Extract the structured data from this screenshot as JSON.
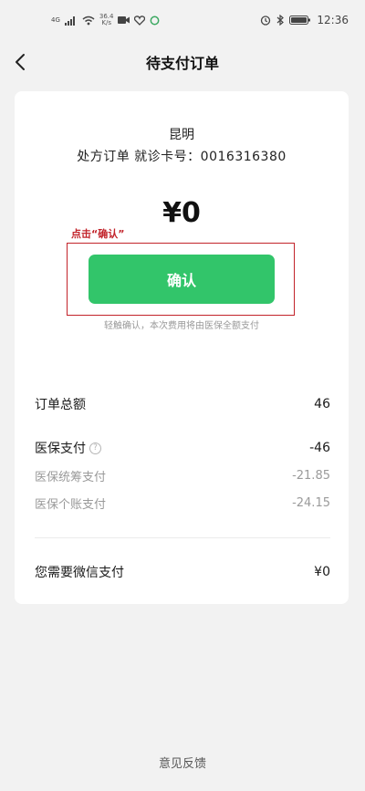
{
  "status_bar": {
    "network": "4G",
    "speed_value": "36.4",
    "speed_unit": "K/s",
    "time": "12:36"
  },
  "nav": {
    "title": "待支付订单"
  },
  "order": {
    "city": "昆明",
    "info": "处方订单 就诊卡号：0016316380",
    "amount": "¥0"
  },
  "annotation": {
    "label": "点击“确认”",
    "color": "#c2232a"
  },
  "confirm": {
    "label": "确认",
    "color": "#32c56a"
  },
  "hint": "轻触确认，本次费用将由医保全额支付",
  "summary": {
    "total_label": "订单总额",
    "total_value": "46",
    "insurance_label": "医保支付",
    "insurance_help": "?",
    "insurance_value": "-46",
    "pool_label": "医保统筹支付",
    "pool_value": "-21.85",
    "personal_label": "医保个账支付",
    "personal_value": "-24.15",
    "wechat_label": "您需要微信支付",
    "wechat_value": "¥0"
  },
  "footer": {
    "feedback": "意见反馈"
  },
  "icons": {
    "signal": "signal-icon",
    "wifi": "wifi-icon",
    "video": "video-icon",
    "heart": "heart-icon",
    "alarm": "alarm-icon",
    "bluetooth": "bluetooth-icon",
    "battery": "battery-icon",
    "back": "chevron-left-icon"
  }
}
